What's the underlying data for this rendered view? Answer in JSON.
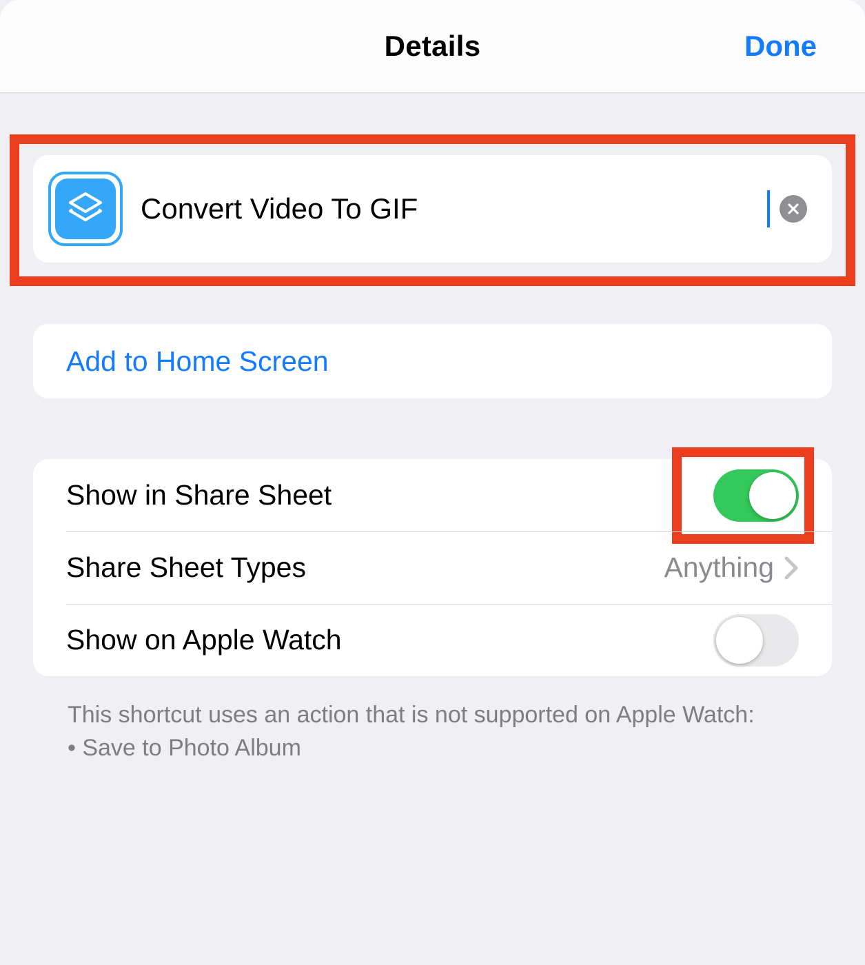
{
  "header": {
    "title": "Details",
    "done_label": "Done"
  },
  "name_card": {
    "icon_name": "shortcuts-app-icon",
    "shortcut_name": "Convert Video To GIF"
  },
  "home_screen": {
    "label": "Add to Home Screen"
  },
  "settings": {
    "share_sheet": {
      "label": "Show in Share Sheet",
      "on": true
    },
    "share_sheet_types": {
      "label": "Share Sheet Types",
      "value": "Anything"
    },
    "apple_watch": {
      "label": "Show on Apple Watch",
      "on": false
    }
  },
  "footnote": {
    "line1": "This shortcut uses an action that is not supported on Apple Watch:",
    "bullet1": "• Save to Photo Album"
  },
  "colors": {
    "accent": "#147bff",
    "highlight": "#ea3e1e",
    "toggle_on": "#34c759"
  }
}
